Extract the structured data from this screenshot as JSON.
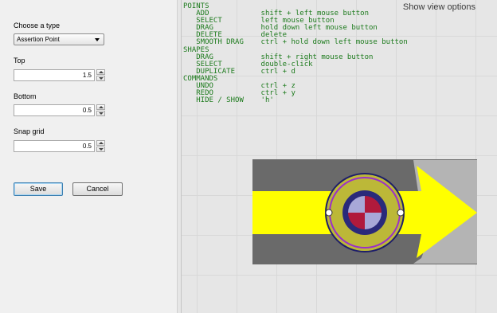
{
  "form": {
    "type_label": "Choose a type",
    "type_value": "Assertion Point",
    "top_label": "Top",
    "top_value": "1.5",
    "bottom_label": "Bottom",
    "bottom_value": "0.5",
    "snap_label": "Snap grid",
    "snap_value": "0.5",
    "save_label": "Save",
    "cancel_label": "Cancel"
  },
  "canvas": {
    "view_options_label": "Show view options",
    "help_lines": [
      "POINTS",
      "   ADD            shift + left mouse button",
      "   SELECT         left mouse button",
      "   DRAG           hold down left mouse button",
      "   DELETE         delete",
      "   SMOOTH DRAG    ctrl + hold down left mouse button",
      "SHAPES",
      "   DRAG           shift + right mouse button",
      "   SELECT         double-click",
      "   DUPLICATE      ctrl + d",
      "COMMANDS",
      "   UNDO           ctrl + z",
      "   REDO           ctrl + y",
      "   HIDE / SHOW    'h'"
    ]
  },
  "colors": {
    "help_text": "#1c7a1c",
    "arrow_fill": "#ffff00",
    "shape_bg": "#6a6a6a",
    "marker_red": "#b01a3c",
    "marker_blue": "#a8a8d8",
    "ring_purple": "#9b30c8",
    "ring_navy": "#2a2a7a"
  }
}
